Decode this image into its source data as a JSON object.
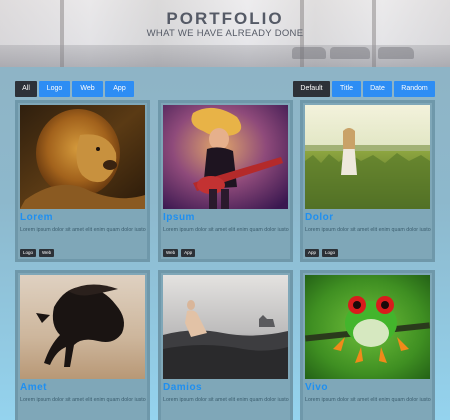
{
  "hero": {
    "title": "PORTFOLIO",
    "subtitle": "WHAT WE HAVE ALREADY DONE"
  },
  "filters": {
    "all": "All",
    "logo": "Logo",
    "web": "Web",
    "app": "App"
  },
  "sort": {
    "default": "Default",
    "title": "Title",
    "date": "Date",
    "random": "Random"
  },
  "cards": [
    {
      "title": "Lorem",
      "description": "Lorem ipsum dolor sit amet elit enim quam dolor iusto",
      "tags": [
        "Logo",
        "Web"
      ],
      "image": "lion"
    },
    {
      "title": "Ipsum",
      "description": "Lorem ipsum dolor sit amet elit enim quam dolor iusto",
      "tags": [
        "Web",
        "App"
      ],
      "image": "guitarist"
    },
    {
      "title": "Dolor",
      "description": "Lorem ipsum dolor sit amet elit enim quam dolor iusto",
      "tags": [
        "App",
        "Logo"
      ],
      "image": "girl-in-field"
    },
    {
      "title": "Amet",
      "description": "Lorem ipsum dolor sit amet elit enim quam dolor iusto",
      "tags": [],
      "image": "horse"
    },
    {
      "title": "Damios",
      "description": "Lorem ipsum dolor sit amet elit enim quam dolor iusto",
      "tags": [],
      "image": "woman-and-cat"
    },
    {
      "title": "Vivo",
      "description": "Lorem ipsum dolor sit amet elit enim quam dolor iusto",
      "tags": [],
      "image": "frog"
    }
  ],
  "colors": {
    "accent": "#2d8df4",
    "dark_button": "#2d3138",
    "card_title": "#1f8ff0"
  }
}
